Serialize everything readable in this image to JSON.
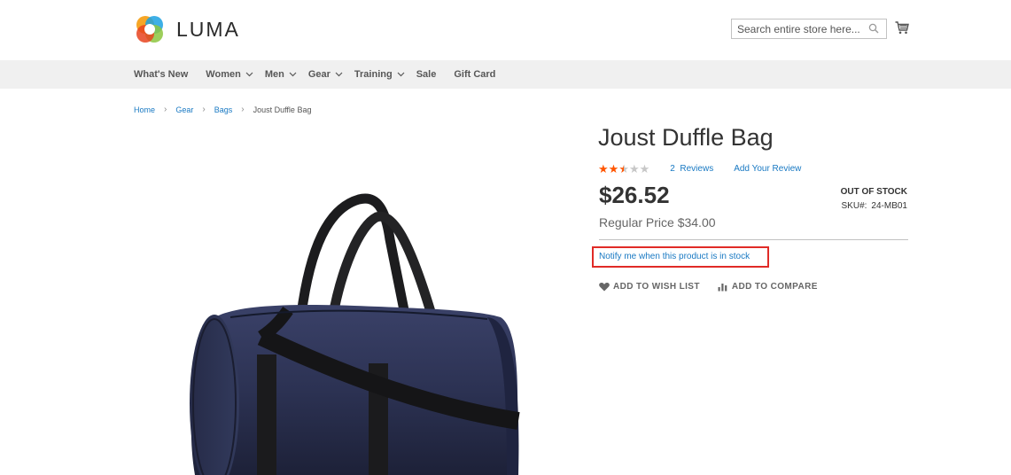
{
  "header": {
    "logo_text": "LUMA",
    "search_placeholder": "Search entire store here...",
    "icons": {
      "search": "search-icon",
      "cart": "cart-icon"
    }
  },
  "nav": {
    "items": [
      {
        "label": "What's New",
        "has_menu": false
      },
      {
        "label": "Women",
        "has_menu": true
      },
      {
        "label": "Men",
        "has_menu": true
      },
      {
        "label": "Gear",
        "has_menu": true
      },
      {
        "label": "Training",
        "has_menu": true
      },
      {
        "label": "Sale",
        "has_menu": false
      },
      {
        "label": "Gift Card",
        "has_menu": false
      }
    ]
  },
  "breadcrumb": {
    "items": [
      "Home",
      "Gear",
      "Bags"
    ],
    "current": "Joust Duffle Bag",
    "separator": ">"
  },
  "product": {
    "name": "Joust Duffle Bag",
    "rating_fraction": 0.5,
    "reviews_link": "2  Reviews",
    "add_review": "Add Your Review",
    "price": "$26.52",
    "regular_price": "Regular Price $34.00",
    "stock_status": "OUT OF STOCK",
    "sku_label": "SKU#:",
    "sku_value": "24-MB01",
    "notify_text": "Notify me when this product is in stock",
    "wishlist_label": "ADD TO WISH LIST",
    "compare_label": "ADD TO COMPARE"
  },
  "colors": {
    "link": "#1979c3",
    "star": "#ff5501",
    "star_empty": "#c7c7c7",
    "highlight_border": "#e02b27",
    "nav_bg": "#f0f0f0"
  }
}
